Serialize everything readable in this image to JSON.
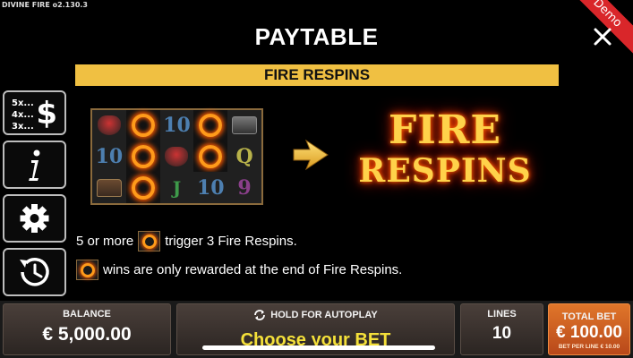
{
  "app": {
    "version": "DIVINE FIRE  o2.130.3",
    "demo_label": "Demo"
  },
  "header": {
    "title": "PAYTABLE",
    "section": "FIRE RESPINS"
  },
  "side_menu": {
    "paytable_multipliers": [
      "5x...",
      "4x...",
      "3x..."
    ],
    "paytable_symbol": "$"
  },
  "reels": {
    "rows": [
      [
        "pot",
        "ring",
        "10",
        "ring",
        "anvil"
      ],
      [
        "10",
        "ring",
        "pot",
        "ring",
        "Q"
      ],
      [
        "chest",
        "ring",
        "J",
        "10",
        "9"
      ]
    ]
  },
  "feature_logo": {
    "line1": "FIRE",
    "line2": "RESPINS"
  },
  "info": {
    "line1_prefix": "5 or more",
    "line1_suffix": "trigger 3 Fire Respins.",
    "line2_suffix": "wins are only rewarded at the end of Fire Respins."
  },
  "bottom": {
    "balance_label": "BALANCE",
    "balance_value": "€ 5,000.00",
    "autoplay_label": "HOLD FOR AUTOPLAY",
    "bet_prompt": "Choose your BET",
    "lines_label": "LINES",
    "lines_value": "10",
    "total_bet_label": "TOTAL BET",
    "total_bet_value": "€ 100.00",
    "bet_per_line": "BET PER LINE € 10.00"
  },
  "colors": {
    "section_bar": "#f0c042",
    "bet_prompt": "#f4e03a",
    "total_bet_panel": "#d0652a",
    "demo_ribbon": "#d9262a"
  },
  "icons": {
    "close": "close-icon",
    "info": "info-icon",
    "settings": "gear-icon",
    "history": "history-icon",
    "autoplay": "autoplay-icon",
    "arrow": "arrow-right-icon",
    "fire_ring": "fire-ring-icon"
  }
}
